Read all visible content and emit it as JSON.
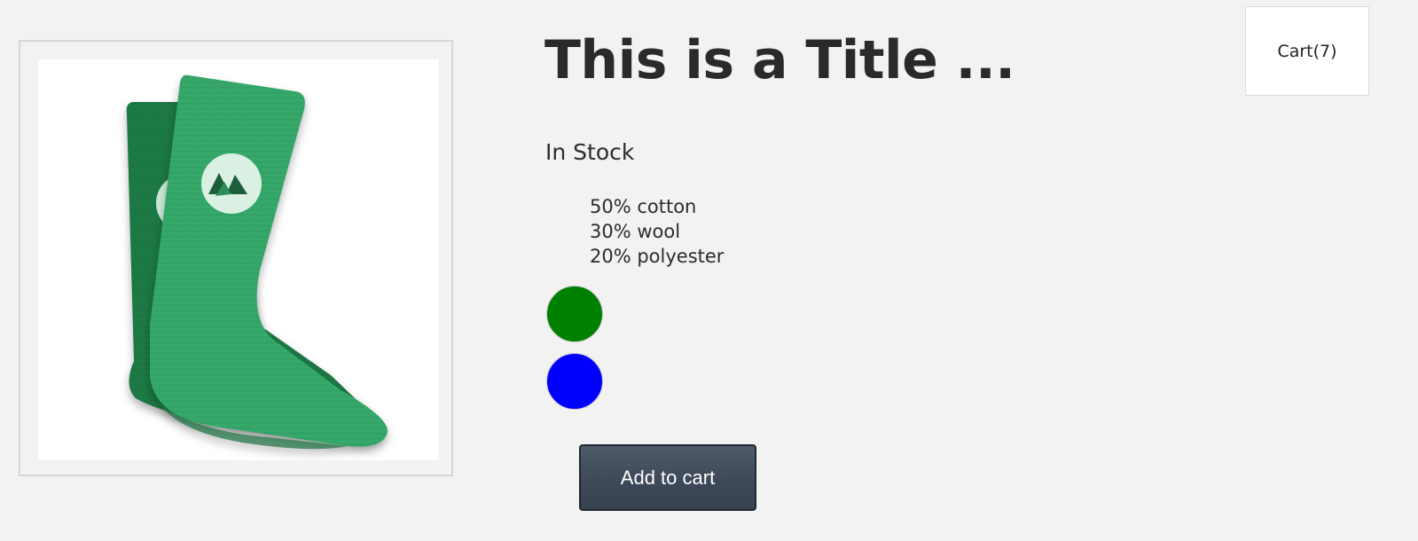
{
  "product": {
    "title": "This is a Title ...",
    "stock_status": "In Stock",
    "materials": [
      "50% cotton",
      "30% wool",
      "20% polyester"
    ],
    "image": {
      "subject": "green-sock-pair",
      "colors": {
        "front_sock": "#36a86a",
        "back_sock": "#1f7a45",
        "logo_circle": "#d9f0e2",
        "logo_mark": "#1d5e3a"
      }
    },
    "color_options": [
      {
        "name": "green",
        "color": "#008000"
      },
      {
        "name": "blue",
        "color": "#0000ff"
      }
    ],
    "add_to_cart_label": "Add to cart"
  },
  "cart": {
    "label": "Cart(7)"
  },
  "theme": {
    "page_background": "#f2f2f2",
    "button_background": "#3f4b5b",
    "button_text": "#ffffff"
  }
}
